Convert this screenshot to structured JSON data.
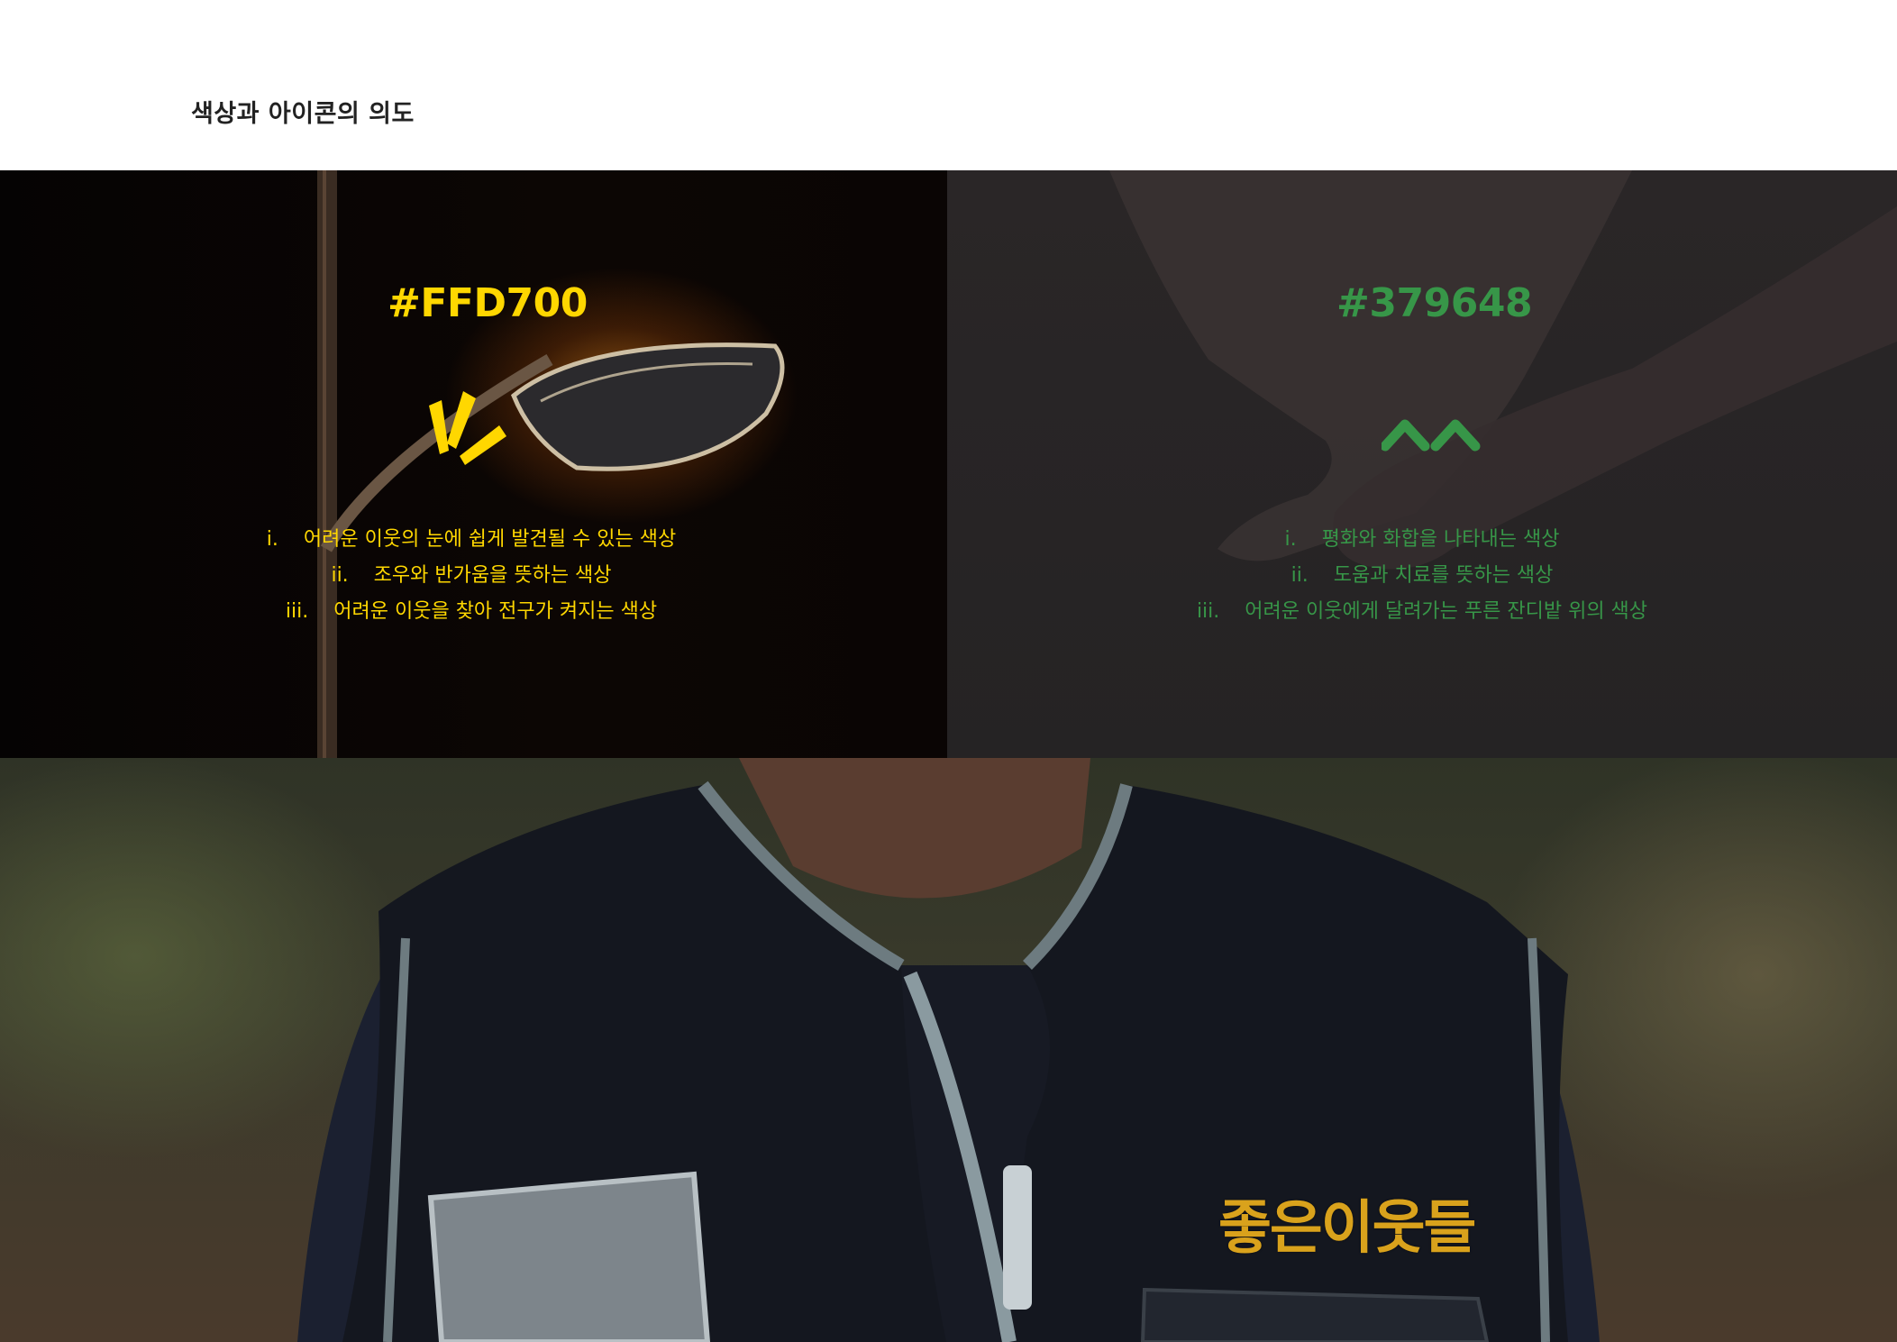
{
  "header": {
    "title": "색상과 아이콘의 의도"
  },
  "colors": {
    "yellow": "#FFD700",
    "green": "#379648"
  },
  "yellow_panel": {
    "hex_label": "#FFD700",
    "icon": "sparkle-rays-icon",
    "items": [
      {
        "num": "i.",
        "text": "어려운 이웃의 눈에 쉽게 발견될 수 있는 색상"
      },
      {
        "num": "ii.",
        "text": "조우와 반가움을 뜻하는 색상"
      },
      {
        "num": "iii.",
        "text": "어려운 이웃을 찾아 전구가 켜지는 색상"
      }
    ]
  },
  "green_panel": {
    "hex_label": "#379648",
    "icon": "double-chevron-up-icon",
    "items": [
      {
        "num": "i.",
        "text": "평화와 화합을 나타내는 색상"
      },
      {
        "num": "ii.",
        "text": "도움과 치료를 뜻하는 색상"
      },
      {
        "num": "iii.",
        "text": "어려운 이웃에게 달려가는 푸른 잔디밭 위의 색상"
      }
    ]
  },
  "vest_photo": {
    "embroidery_text": "좋은이웃들"
  }
}
